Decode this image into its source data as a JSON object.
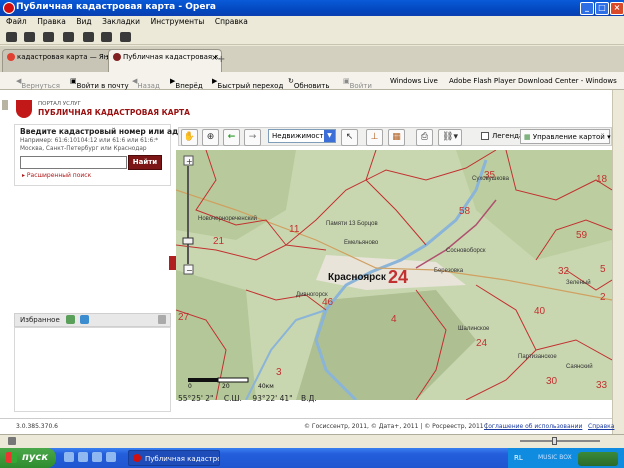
{
  "window": {
    "title": "Публичная кадастровая карта - Opera"
  },
  "menu": [
    "Файл",
    "Правка",
    "Вид",
    "Закладки",
    "Инструменты",
    "Справка"
  ],
  "tabs": [
    {
      "label": "кадастровая карта — Янд...",
      "active": false
    },
    {
      "label": "Публичная кадастровая к...",
      "active": true
    }
  ],
  "navbar": {
    "back": "Вернуться",
    "login": "Войти в почту",
    "prev": "Назад",
    "forward": "Вперёд",
    "fast": "Быстрый переход",
    "refresh": "Обновить",
    "signin": "Войти",
    "live": "Windows Live",
    "flash": "Adobe Flash Player Download Center - Windows"
  },
  "header": {
    "small": "ПОРТАЛ УСЛУГ",
    "title": "ПУБЛИЧНАЯ КАДАСТРОВАЯ КАРТА"
  },
  "search": {
    "label": "Введите кадастровый номер или адрес:",
    "example1": "Например: 61:6:10104:12 или 61:6 или 61:6:*",
    "example2": "Москва, Санкт-Петербург или Краснодар",
    "value": "",
    "button": "Найти",
    "advanced": "Расширенный поиск"
  },
  "favorites": {
    "label": "Избранное"
  },
  "maptoolbar": {
    "layer": "Недвижимость",
    "legend": "Легенда",
    "map_control": "Управление картой"
  },
  "map": {
    "city": "Красноярск",
    "district_main": "24",
    "numbers": [
      "21",
      "11",
      "35",
      "18",
      "58",
      "59",
      "46",
      "27",
      "4",
      "3",
      "24",
      "40",
      "30",
      "33",
      "32",
      "2",
      "5"
    ],
    "places": [
      "Новочернореченский",
      "Памяти 13 Борцов",
      "Емельяново",
      "Сосновоборск",
      "Березовка",
      "Дивногорск",
      "Шалинское",
      "Партизанское",
      "Саянский",
      "Зеленый",
      "Суховушкова"
    ],
    "scale_labels": [
      "0",
      "20",
      "40км"
    ]
  },
  "coords": {
    "lat": "55°25' 2\"",
    "lat_label": "С.Ш.",
    "lon": "93°22' 41\"",
    "lon_label": "В.Д."
  },
  "footer": {
    "version": "3.0.385.370.6",
    "copyright": "© Госиссентр, 2011, © Дата+, 2011 | © Росреестр, 2011 |",
    "terms": "Соглашение об использовании",
    "help": "Справка"
  },
  "taskbar": {
    "start": "пуск",
    "item": "Публичная кадастрова...",
    "tray_rl": "RL",
    "tray_music": "MUSIC BOX"
  },
  "colors": {
    "accent": "#7c1616",
    "title_bar": "#0348c0",
    "boundary": "#c23030",
    "taskbar": "#245edb"
  }
}
